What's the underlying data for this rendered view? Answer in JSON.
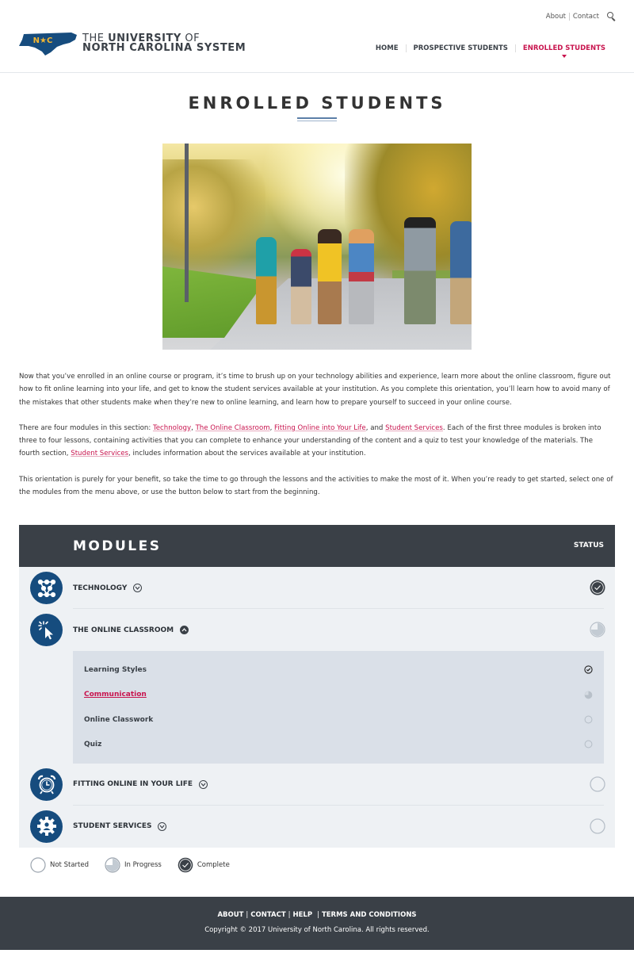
{
  "header": {
    "logo": {
      "state_initials": "N★C",
      "line1_prefix": "THE ",
      "line1_bold": "UNIVERSITY",
      "line1_suffix": " OF",
      "line2": "NORTH CAROLINA SYSTEM"
    },
    "utility_links": [
      {
        "label": "About"
      },
      {
        "label": "Contact"
      }
    ],
    "search_icon": "search-icon",
    "nav": [
      {
        "label": "HOME",
        "active": false
      },
      {
        "label": "PROSPECTIVE STUDENTS",
        "active": false
      },
      {
        "label": "ENROLLED STUDENTS",
        "active": true
      }
    ]
  },
  "page": {
    "title": "ENROLLED STUDENTS",
    "hero_alt": "Group of students walking on a tree-lined campus path"
  },
  "intro": {
    "p1": "Now that you’ve enrolled in an online course or program, it’s time to brush up on your technology abilities and experience, learn more about the online classroom, figure out how to fit online learning into your life, and get to know the student services available at your institution. As you complete this orientation, you’ll learn how to avoid many of the mistakes that other students make when they’re new to online learning, and learn how to prepare yourself to succeed in your online course.",
    "p2": {
      "prefix": "There are four modules in this section: ",
      "link1": "Technology",
      "sep1": ", ",
      "link2": "The Online Classroom",
      "sep2": ", ",
      "link3": "Fitting Online into Your Life",
      "sep3": ", and ",
      "link4": "Student Services",
      "middle": ". Each of the first three modules is broken into three to four lessons, containing activities that you can complete to enhance your understanding of the content and a quiz to test your knowledge of the materials. The fourth section, ",
      "link5": "Student Services",
      "suffix": ", includes information about the services available at your institution."
    },
    "p3": "This orientation is purely for your benefit, so take the time to go through the lessons and the activities to make the most of it. When you’re ready to get started, select one of the modules from the menu above, or use the button below to start from the beginning."
  },
  "modules": {
    "title": "MODULES",
    "status_header": "STATUS",
    "items": [
      {
        "label": "TECHNOLOGY",
        "icon": "network-nodes-icon",
        "expanded": false,
        "status": "complete"
      },
      {
        "label": "THE ONLINE CLASSROOM",
        "icon": "cursor-click-icon",
        "expanded": true,
        "status": "in-progress",
        "lessons": [
          {
            "label": "Learning Styles",
            "status": "complete",
            "current": false
          },
          {
            "label": "Communication",
            "status": "in-progress",
            "current": true
          },
          {
            "label": "Online Classwork",
            "status": "not-started",
            "current": false
          },
          {
            "label": "Quiz",
            "status": "not-started",
            "current": false
          }
        ]
      },
      {
        "label": "FITTING ONLINE IN YOUR LIFE",
        "icon": "alarm-clock-icon",
        "expanded": false,
        "status": "not-started"
      },
      {
        "label": "STUDENT SERVICES",
        "icon": "gear-person-icon",
        "expanded": false,
        "status": "not-started"
      }
    ]
  },
  "legend": [
    {
      "label": "Not Started",
      "status": "not-started"
    },
    {
      "label": "In Progress",
      "status": "in-progress"
    },
    {
      "label": "Complete",
      "status": "complete"
    }
  ],
  "footer": {
    "links": [
      {
        "label": "ABOUT"
      },
      {
        "label": "CONTACT"
      },
      {
        "label": "HELP"
      },
      {
        "label": "TERMS AND CONDITIONS"
      }
    ],
    "copyright": "Copyright © 2017 University of North Carolina. All rights reserved."
  },
  "colors": {
    "accent": "#c8144e",
    "brand_blue": "#164c7e",
    "dark": "#3a4047",
    "logo_gold": "#f2b632"
  }
}
